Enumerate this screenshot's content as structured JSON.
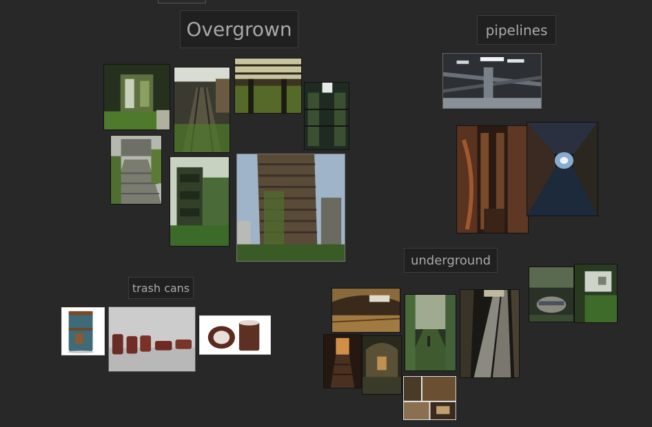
{
  "labels": {
    "overgrown": "Overgrown",
    "pipelines": "pipelines",
    "trash_cans": "trash cans",
    "underground": "underground"
  }
}
